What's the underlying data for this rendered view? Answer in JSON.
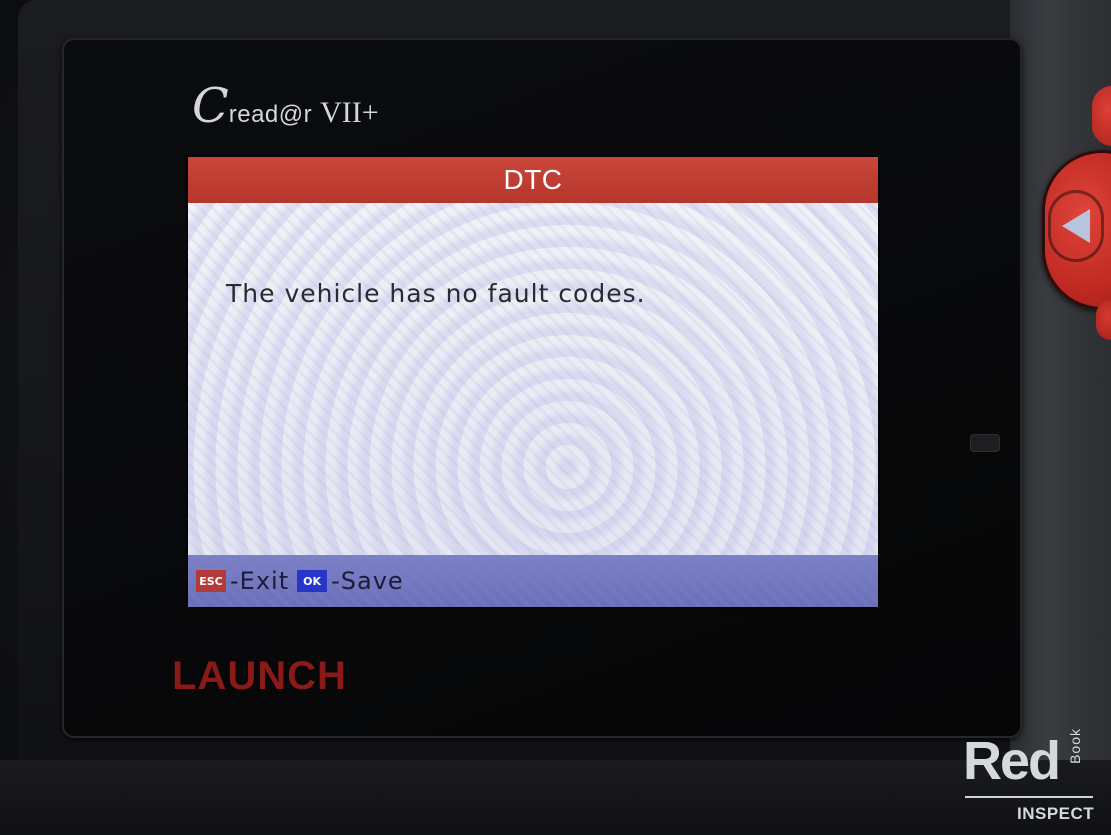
{
  "device": {
    "brand_c": "C",
    "brand_name": "read@r",
    "brand_model": "VII+",
    "maker_logo": "LAUNCH"
  },
  "screen": {
    "title": "DTC",
    "message": "The vehicle has no fault codes.",
    "footer": {
      "esc_badge": "ESC",
      "esc_label": "-Exit",
      "ok_badge": "OK",
      "ok_label": "-Save"
    }
  },
  "watermark": {
    "red": "Red",
    "book": "Book",
    "inspect": "INSPECT"
  },
  "colors": {
    "title_bar": "#b5362c",
    "esc_badge": "#b23a3a",
    "ok_badge": "#2636c9",
    "footer_bar": "#6b6fb8",
    "control_pad": "#bf2a22"
  },
  "icons": {
    "nav_left": "left-arrow-icon"
  }
}
